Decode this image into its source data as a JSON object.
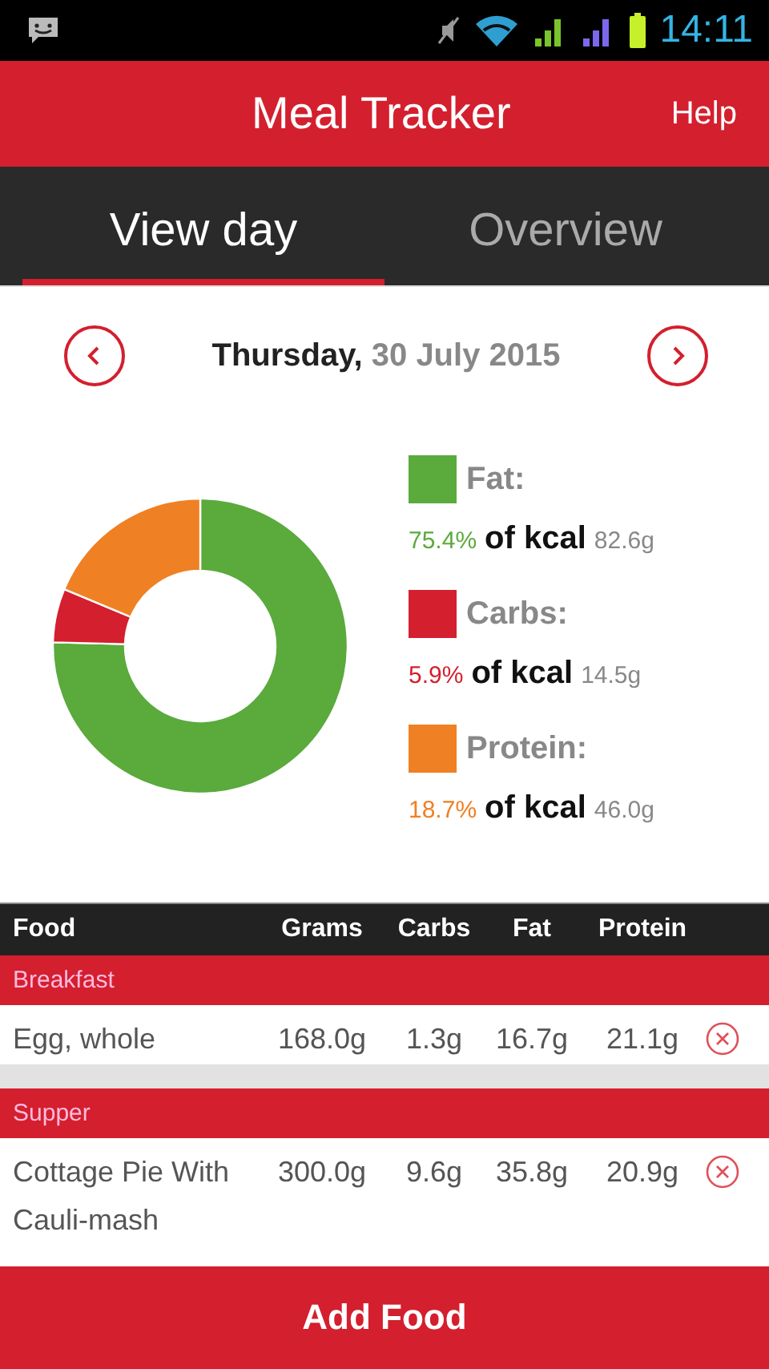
{
  "status_bar": {
    "time": "14:11"
  },
  "app_bar": {
    "title": "Meal Tracker",
    "action": "Help"
  },
  "tabs": [
    {
      "label": "View day",
      "selected": true
    },
    {
      "label": "Overview",
      "selected": false
    }
  ],
  "date": "**Thursday,** 30 July 2015",
  "macros": {
    "chart_data": {
      "type": "donut",
      "values": [
        75.4,
        5.9,
        18.7
      ],
      "colors": [
        "#5aaa3c",
        "#d41f2e",
        "#ef8024"
      ]
    },
    "legend": [
      {
        "label": "Fat:",
        "share": "75.4%",
        "unit": "of kcal",
        "grams": "82.6g"
      },
      {
        "label": "Carbs:",
        "share": "5.9%",
        "unit": "of kcal",
        "grams": "14.5g"
      },
      {
        "label": "Protein:",
        "share": "18.7%",
        "unit": "of kcal",
        "grams": "46.0g"
      }
    ]
  },
  "table": {
    "columns": [
      "Food",
      "Grams",
      "Carbs",
      "Fat",
      "Protein"
    ],
    "groups": [
      {
        "name": "Breakfast",
        "rows": [
          {
            "food": "Egg, whole",
            "grams": "168.0g",
            "carbs": "1.3g",
            "fat": "16.7g",
            "protein": "21.1g"
          }
        ]
      },
      {
        "name": "Supper",
        "rows": [
          {
            "food": "Cottage Pie With Cauli-mash",
            "grams": "300.0g",
            "carbs": "9.6g",
            "fat": "35.8g",
            "protein": "20.9g"
          }
        ]
      }
    ]
  },
  "add_button": "Add Food"
}
